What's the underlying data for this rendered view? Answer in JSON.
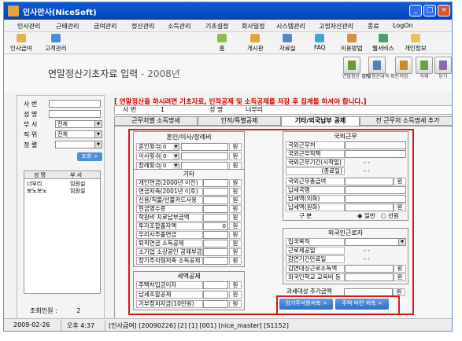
{
  "window": {
    "title": "인사만사(NiceSoft)"
  },
  "menu": [
    "인사관리",
    "근태관리",
    "급여관리",
    "정산관리",
    "소득관리",
    "기초설정",
    "회사일정",
    "시스템관리",
    "고정자산관리",
    "종료",
    "LogOn"
  ],
  "toolbar": {
    "left": [
      {
        "label": "인사급여",
        "icon": "people-icon",
        "color": "#e8b04b"
      },
      {
        "label": "고객관리",
        "icon": "customer-icon",
        "color": "#4a8bd6"
      }
    ],
    "right": [
      {
        "label": "홈",
        "icon": "home-icon",
        "color": "#8bbf4a"
      },
      {
        "label": "게시판",
        "icon": "board-icon",
        "color": "#e6a23c"
      },
      {
        "label": "자료실",
        "icon": "archive-icon",
        "color": "#5a86c7"
      },
      {
        "label": "FAQ",
        "icon": "faq-icon",
        "color": "#3fa5d9"
      },
      {
        "label": "이용방법",
        "icon": "guide-icon",
        "color": "#d98b3f"
      },
      {
        "label": "웹서비스",
        "icon": "web-icon",
        "color": "#4aa06a"
      },
      {
        "label": "개인정보",
        "icon": "personal-icon",
        "color": "#e3c35a"
      }
    ]
  },
  "header": {
    "title": "연말정산기초자료 입력",
    "year": "- 2008년",
    "buttons": [
      {
        "label": "연말정산 집계",
        "icon": "calc-icon",
        "color": "#6a9a3c"
      },
      {
        "label": "연말정산내역 확인",
        "icon": "check-icon",
        "color": "#4e7fc3"
      },
      {
        "label": "저장",
        "icon": "save-icon",
        "color": "#c98a2b"
      },
      {
        "label": "삭제",
        "icon": "trash-icon",
        "color": "#6aa04a"
      },
      {
        "label": "닫기",
        "icon": "close-icon",
        "color": "#8a6ab3"
      }
    ]
  },
  "search": {
    "labels": [
      "사 번",
      "성 명",
      "부 서",
      "직 위",
      "정 렬"
    ],
    "dept_value": "전체",
    "position_value": "전체",
    "button": "조회 >"
  },
  "employee_list": {
    "headers": [
      "성 명",
      "부 서"
    ],
    "rows": [
      {
        "name": "너부리",
        "dept": "임원실"
      },
      {
        "name": "보노보노",
        "dept": "임원실"
      }
    ],
    "count_label": "조회인원 :",
    "count": "2"
  },
  "notice": "[ 연말정산을 하시려면 기초자료, 인적공제 및 소득공제를 저장 후 집계를 하셔야 합니다.]",
  "employee_info": {
    "id_label": "사 번",
    "id_value": "1",
    "name_label": "성 명",
    "name_value": "너부리"
  },
  "tabs": [
    "근무처별 소득명세",
    "인적/특별공제",
    "기타/외국납부 공제",
    "전 근무처 소득명세 추가"
  ],
  "groups": {
    "family": {
      "title": "혼인/이사/장례비",
      "rows": [
        {
          "label": "혼인횟수",
          "value": "0",
          "unit": "원"
        },
        {
          "label": "이사횟수",
          "value": "0",
          "unit": "원"
        },
        {
          "label": "장례횟수",
          "value": "0",
          "unit": "원"
        }
      ]
    },
    "etc": {
      "title": "기타",
      "rows": [
        {
          "label": "개인연금(2000년 이전)",
          "unit": "원"
        },
        {
          "label": "연금저축(2001년 이후)",
          "unit": "원"
        },
        {
          "label": "신용/직불/선불카드사용",
          "unit": "원"
        },
        {
          "label": "현금영수증",
          "unit": "원"
        },
        {
          "label": "학원비 지로납부금액",
          "unit": "원"
        },
        {
          "label": "투자조합출자액",
          "value": "0",
          "unit": "원"
        },
        {
          "label": "우리사주출연금",
          "unit": "원"
        },
        {
          "label": "퇴직연금 소득공제",
          "unit": "원"
        },
        {
          "label": "소기업 소상공인 공제부금",
          "unit": "원"
        },
        {
          "label": "장기주식형저축 소득공제",
          "unit": "원"
        }
      ]
    },
    "tax": {
      "title": "세액공제",
      "rows": [
        {
          "label": "주택차입금이자",
          "unit": "원"
        },
        {
          "label": "납세조합공제",
          "unit": "원"
        },
        {
          "label": "기부정치자금(10만원)",
          "unit": "원"
        }
      ]
    },
    "foreign": {
      "title": "국외근무",
      "rows": [
        {
          "label": "국외근무처",
          "value": ""
        },
        {
          "label": "국외근무직책",
          "value": ""
        },
        {
          "label": "국외근무기간(시작일)",
          "value": "- -"
        },
        {
          "label": "(종료일)",
          "value": "- -"
        },
        {
          "label": "국외근무총급여",
          "unit": "원"
        },
        {
          "label": "납세국명",
          "value": ""
        },
        {
          "label": "납세액(외화)",
          "value": ""
        },
        {
          "label": "납세액(원화)",
          "unit": "원"
        }
      ],
      "division_label": "구 분",
      "options": [
        "일반",
        "선원"
      ]
    },
    "alien": {
      "title": "외국인근로자",
      "rows": [
        {
          "label": "입국목적",
          "value": ""
        },
        {
          "label": "근로제공일",
          "value": "- -"
        },
        {
          "label": "감면기간만료일",
          "value": "- -"
        },
        {
          "label": "감면대상근로소득액",
          "unit": "원"
        },
        {
          "label": "외국인학교 교육비 등",
          "unit": "원"
        }
      ],
      "extra_label": "과세대상 추가금액",
      "extra_unit": "원"
    }
  },
  "bottom_buttons": [
    "장기주식형저축 >",
    "주택 마련 저축 >"
  ],
  "status": {
    "date": "2009-02-26",
    "time": "오후 4:37",
    "info": "[인사급여] [20090226] [2] [1] [001] [nice_master] [S1152]"
  }
}
